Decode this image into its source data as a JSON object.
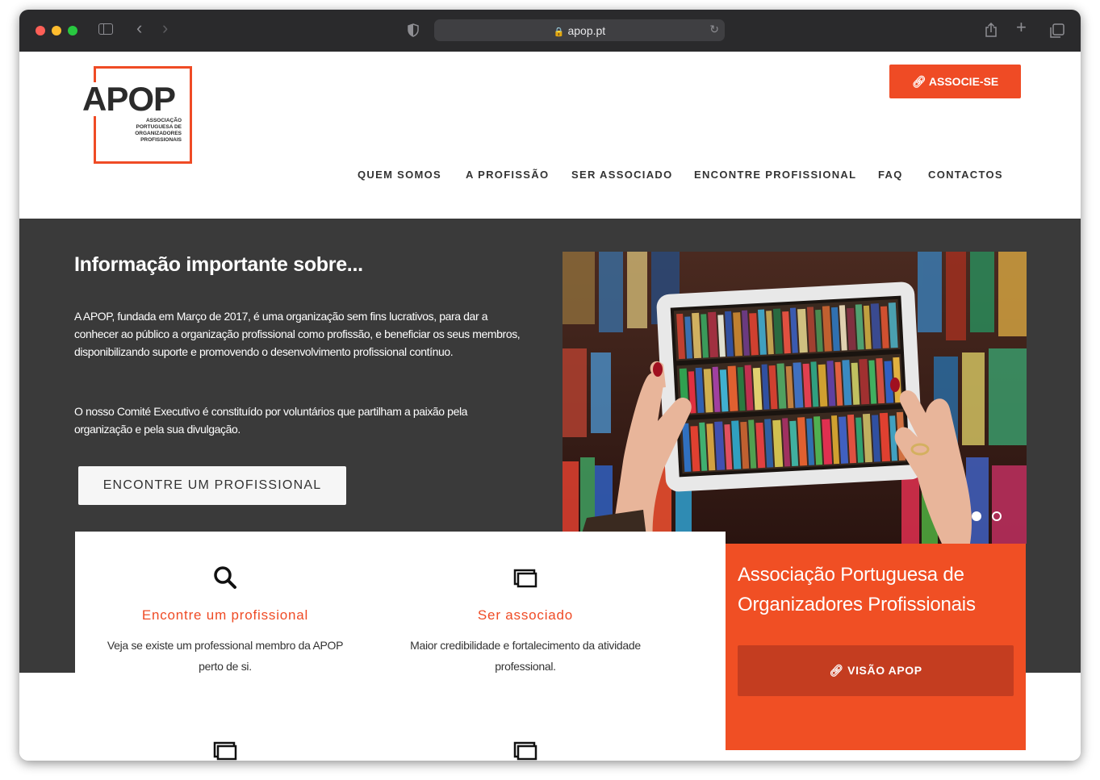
{
  "browser": {
    "url": "apop.pt"
  },
  "header": {
    "logo": {
      "word": "APOP",
      "subtitle": [
        "ASSOCIAÇÃO",
        "PORTUGUESA DE",
        "ORGANIZADORES",
        "PROFISSIONAIS"
      ]
    },
    "cta_label": "ASSOCIE-SE",
    "nav": [
      "QUEM SOMOS",
      "A PROFISSÃO",
      "SER ASSOCIADO",
      "ENCONTRE PROFISSIONAL",
      "FAQ",
      "CONTACTOS"
    ]
  },
  "hero": {
    "title": "Informação importante sobre...",
    "paragraph1": "A  APOP,  fundada em Março de 2017,   é uma organização sem fins lucrativos, para dar a conhecer ao público a organização profissional como profissão, e beneficiar os seus membros, disponibilizando suporte e promovendo o desenvolvimento profissional contínuo.",
    "paragraph2": "O nosso Comité Executivo é constituído por voluntários que partilham a paixão pela organização e pela sua divulgação.",
    "button_label": "ENCONTRE UM PROFISSIONAL",
    "slider": {
      "slide_count": 2,
      "active_slide": 1
    }
  },
  "features": [
    {
      "icon": "search-icon",
      "title": "Encontre um profissional",
      "description": "Veja se existe um professional membro da APOP perto de si."
    },
    {
      "icon": "windows-icon",
      "title": "Ser associado",
      "description": "Maior credibilidade e fortalecimento da atividade professional."
    }
  ],
  "promo": {
    "title": "Associação Portuguesa de Organizadores Profissionais",
    "button_label": "VISÃO APOP"
  },
  "colors": {
    "accent": "#ef4b25",
    "dark_band": "#3a3a3a",
    "button_dark_orange": "#c43d20"
  }
}
